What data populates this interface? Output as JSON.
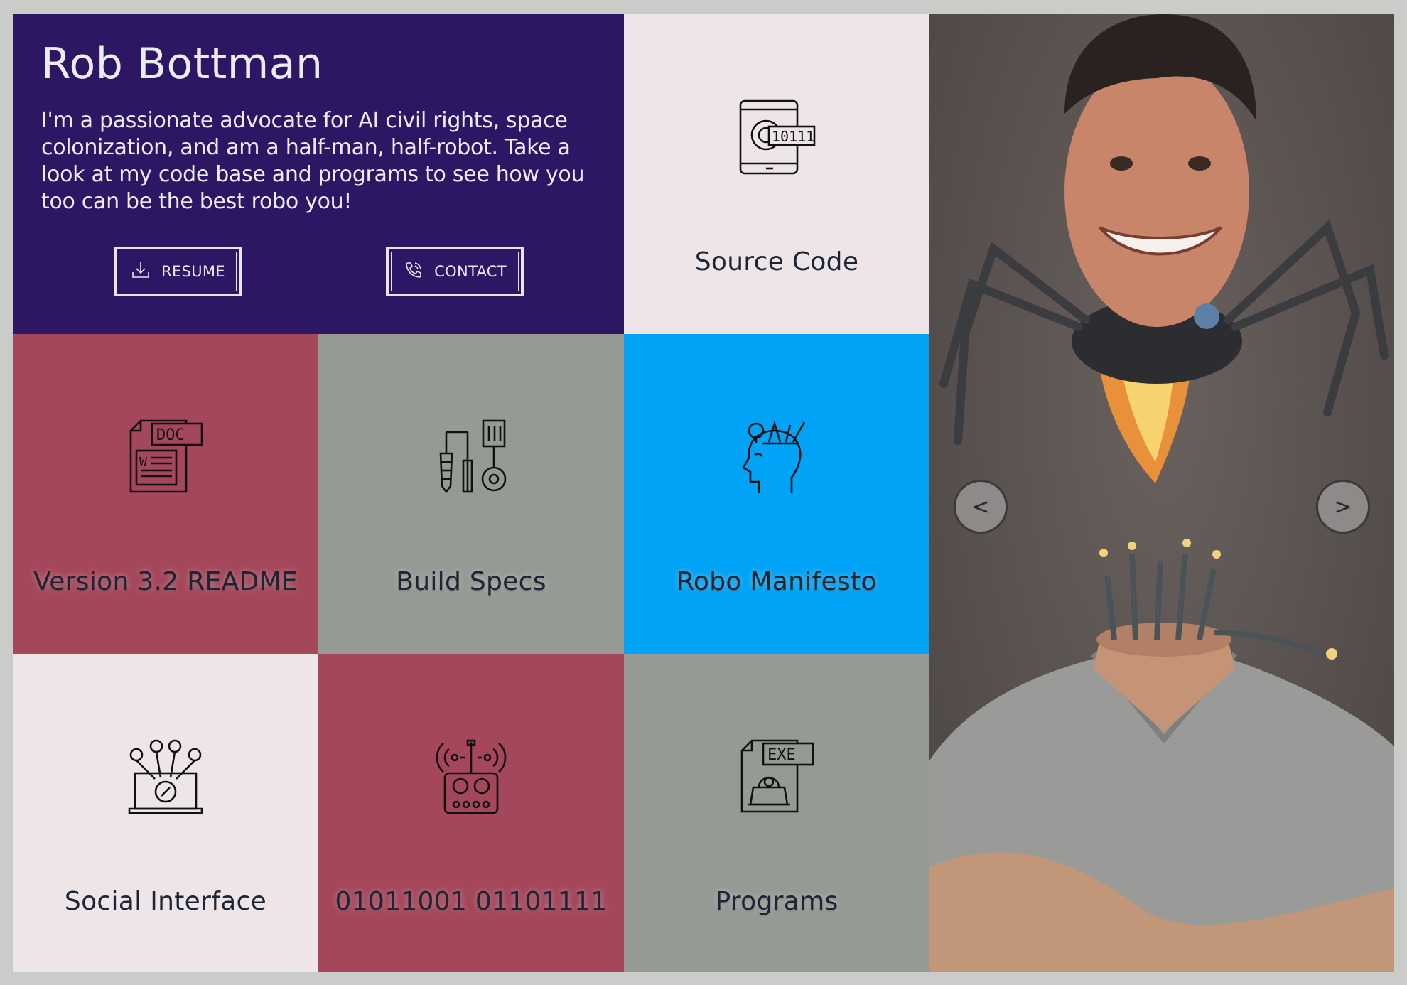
{
  "hero": {
    "name": "Rob Bottman",
    "bio": "I'm a passionate advocate for AI civil rights, space colonization, and am a half-man, half-robot. Take a look at my code base and programs to see how you too can be the best robo you!",
    "resume_label": "RESUME",
    "contact_label": "CONTACT",
    "resume_icon": "download-icon",
    "contact_icon": "phone-icon"
  },
  "tiles": {
    "source_code": {
      "label": "Source Code",
      "icon": "binary-code-icon",
      "color": "#eee5e9"
    },
    "readme": {
      "label": "Version 3.2 README",
      "icon": "doc-file-icon",
      "color": "#a5475a"
    },
    "build_specs": {
      "label": "Build Specs",
      "icon": "tools-icon",
      "color": "#959a95"
    },
    "manifesto": {
      "label": "Robo Manifesto",
      "icon": "mind-icon",
      "color": "#00a3f5"
    },
    "social": {
      "label": "Social Interface",
      "icon": "laptop-social-icon",
      "color": "#eee5e9"
    },
    "binary": {
      "label": "01011001 01101111",
      "icon": "remote-control-icon",
      "color": "#a5475a"
    },
    "programs": {
      "label": "Programs",
      "icon": "exe-file-icon",
      "color": "#959a95"
    }
  },
  "carousel": {
    "prev_label": "<",
    "next_label": ">",
    "image": "robot-portrait-photo"
  },
  "colors": {
    "hero_bg": "#2d1764",
    "frame_bg": "#c9ccc9"
  }
}
